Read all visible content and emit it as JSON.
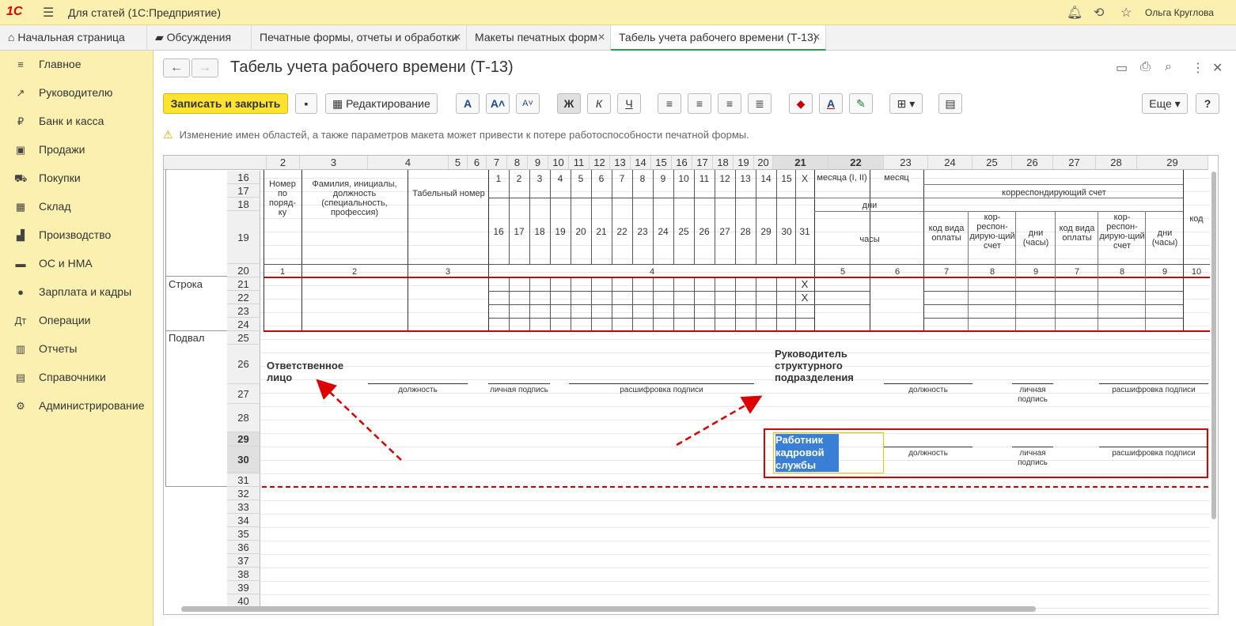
{
  "app": {
    "logo": "1С",
    "title": "Для статей  (1С:Предприятие)",
    "user": "Ольга Круглова"
  },
  "tabs": [
    {
      "label": "Начальная страница"
    },
    {
      "label": "Обсуждения"
    },
    {
      "label": "Печатные формы, отчеты и обработки"
    },
    {
      "label": "Макеты печатных форм"
    },
    {
      "label": "Табель учета рабочего времени (Т-13)"
    }
  ],
  "sidebar": {
    "items": [
      {
        "label": "Главное"
      },
      {
        "label": "Руководителю"
      },
      {
        "label": "Банк и касса"
      },
      {
        "label": "Продажи"
      },
      {
        "label": "Покупки"
      },
      {
        "label": "Склад"
      },
      {
        "label": "Производство"
      },
      {
        "label": "ОС и НМА"
      },
      {
        "label": "Зарплата и кадры"
      },
      {
        "label": "Операции"
      },
      {
        "label": "Отчеты"
      },
      {
        "label": "Справочники"
      },
      {
        "label": "Администрирование"
      }
    ]
  },
  "document": {
    "title": "Табель учета рабочего времени (Т-13)"
  },
  "toolbar": {
    "save_close": "Записать и закрыть",
    "editing": "Редактирование",
    "more": "Еще",
    "help": "?",
    "bold": "Ж",
    "italic": "К",
    "underline": "Ч"
  },
  "warning": "Изменение имен областей, а также параметров макета может привести к потере работоспособности печатной формы.",
  "grid": {
    "columns": [
      "2",
      "3",
      "4",
      "5",
      "6",
      "7",
      "8",
      "9",
      "10",
      "11",
      "12",
      "13",
      "14",
      "15",
      "16",
      "17",
      "18",
      "19",
      "20",
      "21",
      "22",
      "23",
      "24",
      "25",
      "26",
      "27",
      "28",
      "29"
    ],
    "rows": [
      "16",
      "17",
      "18",
      "19",
      "20",
      "21",
      "22",
      "23",
      "24",
      "25",
      "26",
      "27",
      "28",
      "29",
      "30",
      "31",
      "32",
      "33",
      "34",
      "35",
      "36",
      "37",
      "38",
      "39",
      "40"
    ],
    "groups": {
      "row": "Строка",
      "footer": "Подвал"
    },
    "header": {
      "num": "Номер по поряд-ку",
      "fio": "Фамилия, инициалы, должность (специальность, профессия)",
      "tab": "Табельный номер",
      "month_half": "месяца (I, II)",
      "month": "месяц",
      "days": "дни",
      "hours": "часы",
      "corr": "корреспондирующий счет",
      "kod_vida": "код вида оплаты",
      "korr": "кор-респон-дирую-щий счет",
      "dni_chasy": "дни (часы)",
      "kod": "код",
      "days_top": [
        "1",
        "2",
        "3",
        "4",
        "5",
        "6",
        "7",
        "8",
        "9",
        "10",
        "11",
        "12",
        "13",
        "14",
        "15",
        "X"
      ],
      "days_bottom": [
        "16",
        "17",
        "18",
        "19",
        "20",
        "21",
        "22",
        "23",
        "24",
        "25",
        "26",
        "27",
        "28",
        "29",
        "30",
        "31"
      ],
      "colnums": [
        "1",
        "2",
        "3",
        "4",
        "5",
        "6",
        "7",
        "8",
        "9",
        "7",
        "8",
        "9",
        "10"
      ],
      "x": "X"
    },
    "footer": {
      "resp": "Ответственное лицо",
      "head": "Руководитель структурного подразделения",
      "hr": "Работник кадровой службы",
      "position": "должность",
      "signature": "личная подпись",
      "decode": "расшифровка подписи"
    }
  }
}
